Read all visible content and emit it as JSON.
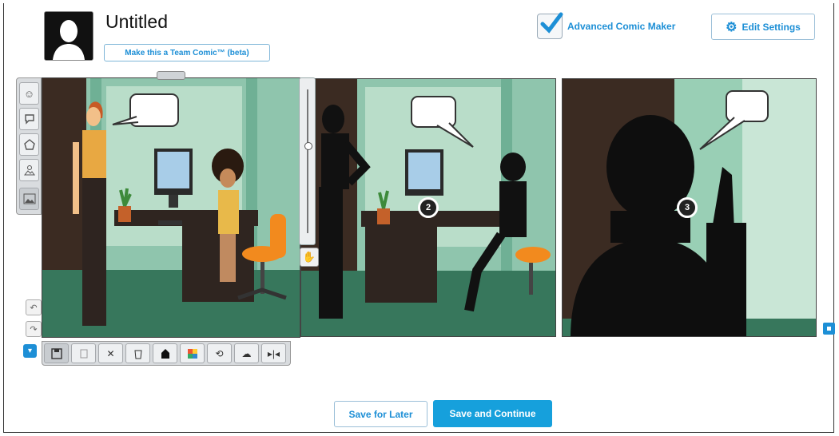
{
  "header": {
    "title": "Untitled",
    "team_comic_label": "Make this a Team Comic™ (beta)",
    "advanced_label": "Advanced Comic Maker",
    "advanced_checked": true,
    "edit_settings_label": "Edit Settings"
  },
  "panels": [
    {
      "number": "",
      "bg": "#8fc5ad"
    },
    {
      "number": "2",
      "bg": "#8fc5ad"
    },
    {
      "number": "3",
      "bg": "#99cfb5"
    }
  ],
  "left_tools": [
    "face-icon",
    "speech-bubble-icon",
    "shape-icon",
    "scene-icon",
    "image-icon"
  ],
  "bottom_tools": [
    "save-icon",
    "copy-icon",
    "delete-icon",
    "trash-icon",
    "silhouette-icon",
    "color-icon",
    "rotate-icon",
    "cloud-icon",
    "flip-icon"
  ],
  "footer": {
    "save_later": "Save for Later",
    "save_continue": "Save and Continue"
  },
  "colors": {
    "accent": "#1d8fd6",
    "primary_button": "#16a0dc"
  }
}
